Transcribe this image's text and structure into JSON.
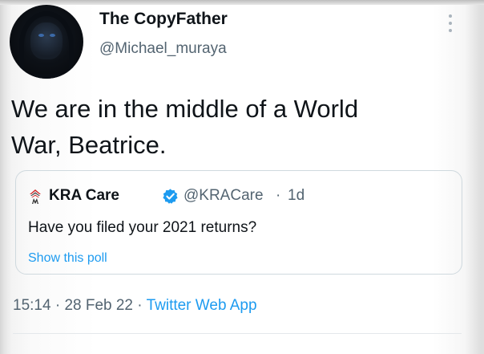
{
  "tweet": {
    "author_name": "The CopyFather",
    "author_handle": "@Michael_muraya",
    "text_line1": "We are in the middle of a World",
    "text_line2": "War, Beatrice.",
    "timestamp_time": "15:14",
    "separator": "·",
    "timestamp_date": "28 Feb 22",
    "source_app": "Twitter Web App"
  },
  "quoted_tweet": {
    "author_name": "KRA Care",
    "author_handle": "@KRACare",
    "separator": "·",
    "age": "1d",
    "text": "Have you filed your 2021 returns?",
    "poll_link": "Show this poll"
  },
  "colors": {
    "link": "#1d9bf0",
    "secondary_text": "#536471",
    "verified_badge": "#1d9bf0",
    "kra_logo": "#d22b2b"
  },
  "icons": {
    "more": "more-vertical-icon",
    "verified": "verified-badge-icon",
    "quoted_logo": "kra-logo-icon"
  }
}
